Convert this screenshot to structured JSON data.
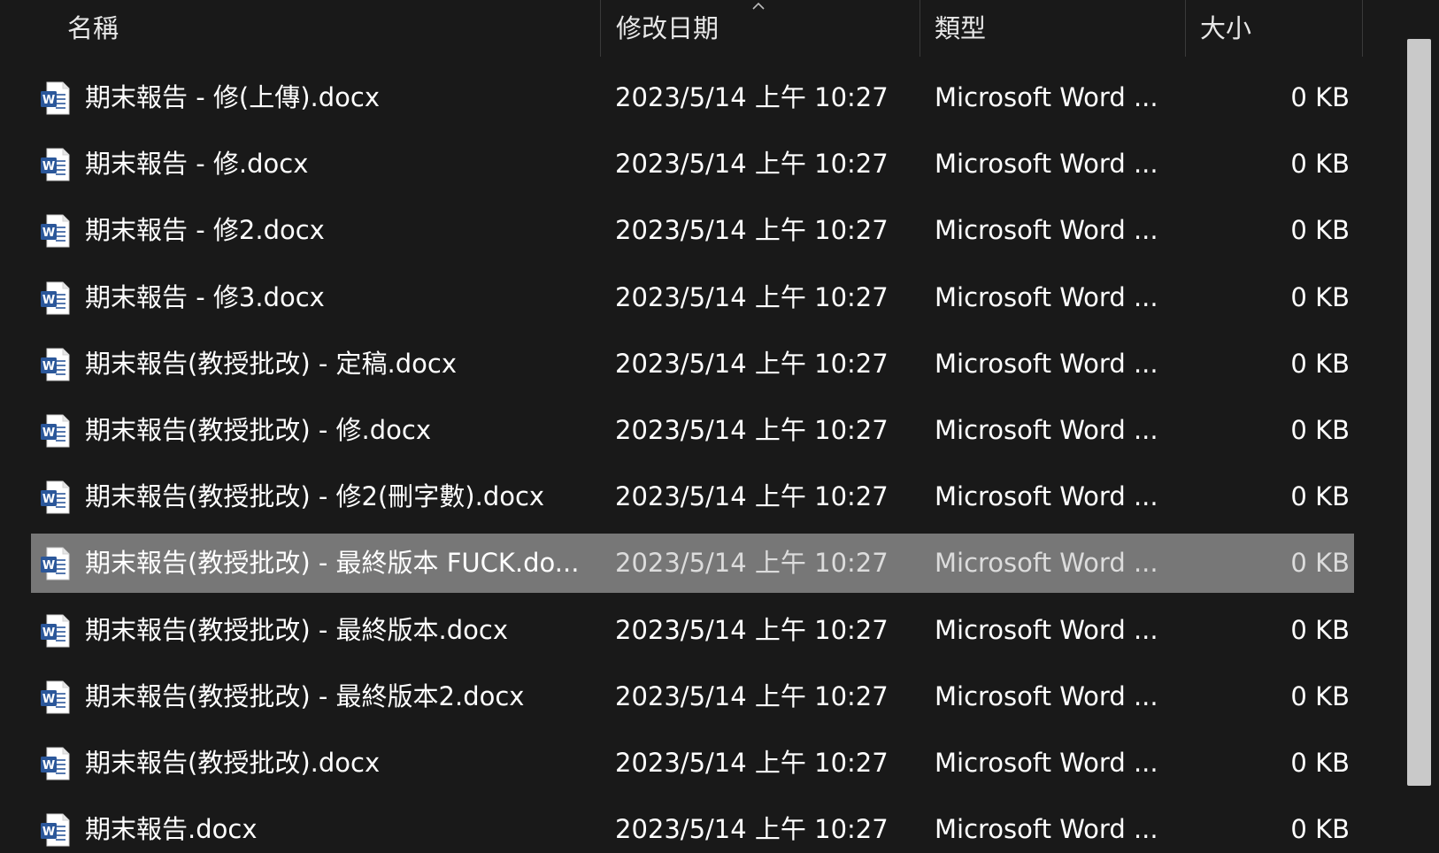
{
  "columns": {
    "name": "名稱",
    "modified": "修改日期",
    "type": "類型",
    "size": "大小"
  },
  "sort": {
    "column": "modified",
    "direction": "ascending",
    "icon": "chevron-up-icon"
  },
  "colors": {
    "background": "#191919",
    "selected_row": "#777777",
    "word_blue": "#2b579a",
    "scrollbar_thumb": "#c9c9c9"
  },
  "files": [
    {
      "name": "期末報告 - 修(上傳).docx",
      "modified": "2023/5/14 上午 10:27",
      "type": "Microsoft Word ...",
      "size": "0 KB",
      "icon": "word-document-icon",
      "selected": false
    },
    {
      "name": "期末報告 - 修.docx",
      "modified": "2023/5/14 上午 10:27",
      "type": "Microsoft Word ...",
      "size": "0 KB",
      "icon": "word-document-icon",
      "selected": false
    },
    {
      "name": "期末報告 - 修2.docx",
      "modified": "2023/5/14 上午 10:27",
      "type": "Microsoft Word ...",
      "size": "0 KB",
      "icon": "word-document-icon",
      "selected": false
    },
    {
      "name": "期末報告 - 修3.docx",
      "modified": "2023/5/14 上午 10:27",
      "type": "Microsoft Word ...",
      "size": "0 KB",
      "icon": "word-document-icon",
      "selected": false
    },
    {
      "name": "期末報告(教授批改) - 定稿.docx",
      "modified": "2023/5/14 上午 10:27",
      "type": "Microsoft Word ...",
      "size": "0 KB",
      "icon": "word-document-icon",
      "selected": false
    },
    {
      "name": "期末報告(教授批改) - 修.docx",
      "modified": "2023/5/14 上午 10:27",
      "type": "Microsoft Word ...",
      "size": "0 KB",
      "icon": "word-document-icon",
      "selected": false
    },
    {
      "name": "期末報告(教授批改) - 修2(刪字數).docx",
      "modified": "2023/5/14 上午 10:27",
      "type": "Microsoft Word ...",
      "size": "0 KB",
      "icon": "word-document-icon",
      "selected": false
    },
    {
      "name": "期末報告(教授批改) - 最終版本 FUCK.do...",
      "modified": "2023/5/14 上午 10:27",
      "type": "Microsoft Word ...",
      "size": "0 KB",
      "icon": "word-document-icon",
      "selected": true
    },
    {
      "name": "期末報告(教授批改) - 最終版本.docx",
      "modified": "2023/5/14 上午 10:27",
      "type": "Microsoft Word ...",
      "size": "0 KB",
      "icon": "word-document-icon",
      "selected": false
    },
    {
      "name": "期末報告(教授批改) - 最終版本2.docx",
      "modified": "2023/5/14 上午 10:27",
      "type": "Microsoft Word ...",
      "size": "0 KB",
      "icon": "word-document-icon",
      "selected": false
    },
    {
      "name": "期末報告(教授批改).docx",
      "modified": "2023/5/14 上午 10:27",
      "type": "Microsoft Word ...",
      "size": "0 KB",
      "icon": "word-document-icon",
      "selected": false
    },
    {
      "name": "期末報告.docx",
      "modified": "2023/5/14 上午 10:27",
      "type": "Microsoft Word ...",
      "size": "0 KB",
      "icon": "word-document-icon",
      "selected": false
    }
  ]
}
